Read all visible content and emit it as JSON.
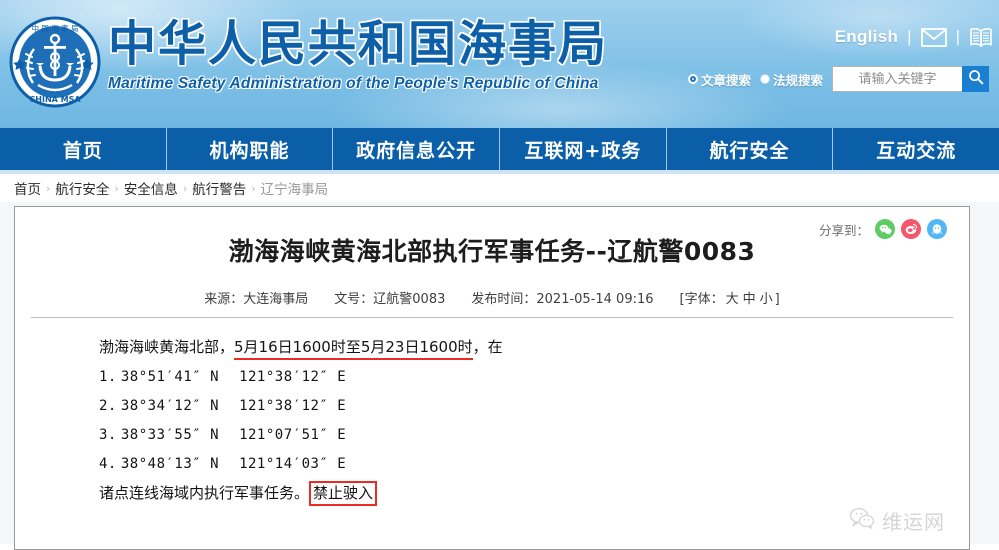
{
  "header": {
    "logo_alt": "China MSA emblem",
    "brand_cn": "中华人民共和国海事局",
    "brand_en": "Maritime Safety Administration of the People's Republic of China",
    "english_link": "English",
    "separator": "|",
    "mail_icon": "envelope-icon",
    "book_icon": "book-icon",
    "search": {
      "options": [
        {
          "label": "文章搜索",
          "selected": true
        },
        {
          "label": "法规搜索",
          "selected": false
        }
      ],
      "placeholder": "请输入关键字",
      "value": "",
      "button_icon": "magnifier-icon"
    }
  },
  "nav": {
    "items": [
      {
        "label": "首页"
      },
      {
        "label": "机构职能"
      },
      {
        "label": "政府信息公开"
      },
      {
        "label": "互联网+政务"
      },
      {
        "label": "航行安全"
      },
      {
        "label": "互动交流"
      }
    ]
  },
  "breadcrumb": {
    "separator": "›",
    "items": [
      {
        "label": "首页",
        "current": false
      },
      {
        "label": "航行安全",
        "current": false
      },
      {
        "label": "安全信息",
        "current": false
      },
      {
        "label": "航行警告",
        "current": false
      },
      {
        "label": "辽宁海事局",
        "current": true
      }
    ]
  },
  "article": {
    "share_label": "分享到：",
    "share_icons": [
      {
        "name": "wechat-share-icon",
        "color": "#5fcb65"
      },
      {
        "name": "weibo-share-icon",
        "color": "#f4566c"
      },
      {
        "name": "qq-share-icon",
        "color": "#51b7f5"
      }
    ],
    "title": "渤海海峡黄海北部执行军事任务--辽航警0083",
    "meta": {
      "source": "来源：大连海事局",
      "doc_number": "文号：辽航警0083",
      "publish_time": "发布时间：2021-05-14 09:16",
      "fontsize_prefix": "[字体：",
      "fontsize_large": "大",
      "fontsize_medium": "中",
      "fontsize_small": "小",
      "fontsize_suffix": "]"
    },
    "body": {
      "lead_prefix": "渤海海峡黄海北部，",
      "lead_highlight": "5月16日1600时至5月23日1600时",
      "lead_suffix": "，在",
      "coordinates": [
        {
          "index": "1.",
          "lat": "38°51′41″ N",
          "lon": "121°38′12″ E"
        },
        {
          "index": "2.",
          "lat": "38°34′12″ N",
          "lon": "121°38′12″ E"
        },
        {
          "index": "3.",
          "lat": "38°33′55″ N",
          "lon": "121°07′51″ E"
        },
        {
          "index": "4.",
          "lat": "38°48′13″ N",
          "lon": "121°14′03″ E"
        }
      ],
      "closing_prefix": "诸点连线海域内执行军事任务。",
      "closing_boxed": "禁止驶入"
    },
    "watermark": {
      "icon": "wechat-icon",
      "text": "维运网"
    }
  },
  "colors": {
    "nav_blue": "#0b5ea8",
    "brand_blue": "#0d5fa8",
    "accent_red": "#ee2a24",
    "header_blue": "#8fc8ea"
  }
}
